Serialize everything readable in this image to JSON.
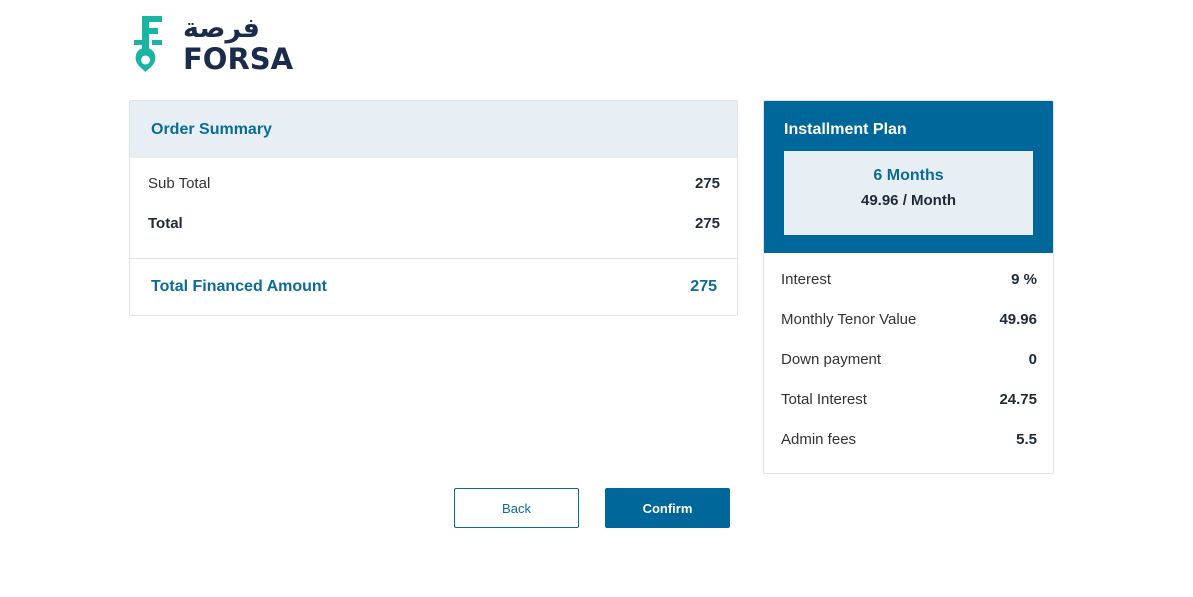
{
  "brand": {
    "name_arabic": "فرصة",
    "name_latin": "FORSA",
    "colors": {
      "primary": "#00679a",
      "accent_teal": "#19b5a2",
      "dark": "#1b2b4b"
    }
  },
  "order_summary": {
    "title": "Order Summary",
    "rows": [
      {
        "label": "Sub Total",
        "value": "275"
      },
      {
        "label": "Total",
        "value": "275"
      }
    ],
    "financed_label": "Total Financed Amount",
    "financed_value": "275"
  },
  "installment_plan": {
    "title": "Installment Plan",
    "months": "6 Months",
    "per_month": "49.96 / Month",
    "rows": [
      {
        "label": "Interest",
        "value": "9 %"
      },
      {
        "label": "Monthly Tenor Value",
        "value": "49.96"
      },
      {
        "label": "Down payment",
        "value": "0"
      },
      {
        "label": "Total Interest",
        "value": "24.75"
      },
      {
        "label": "Admin fees",
        "value": "5.5"
      }
    ]
  },
  "actions": {
    "back_label": "Back",
    "confirm_label": "Confirm"
  }
}
